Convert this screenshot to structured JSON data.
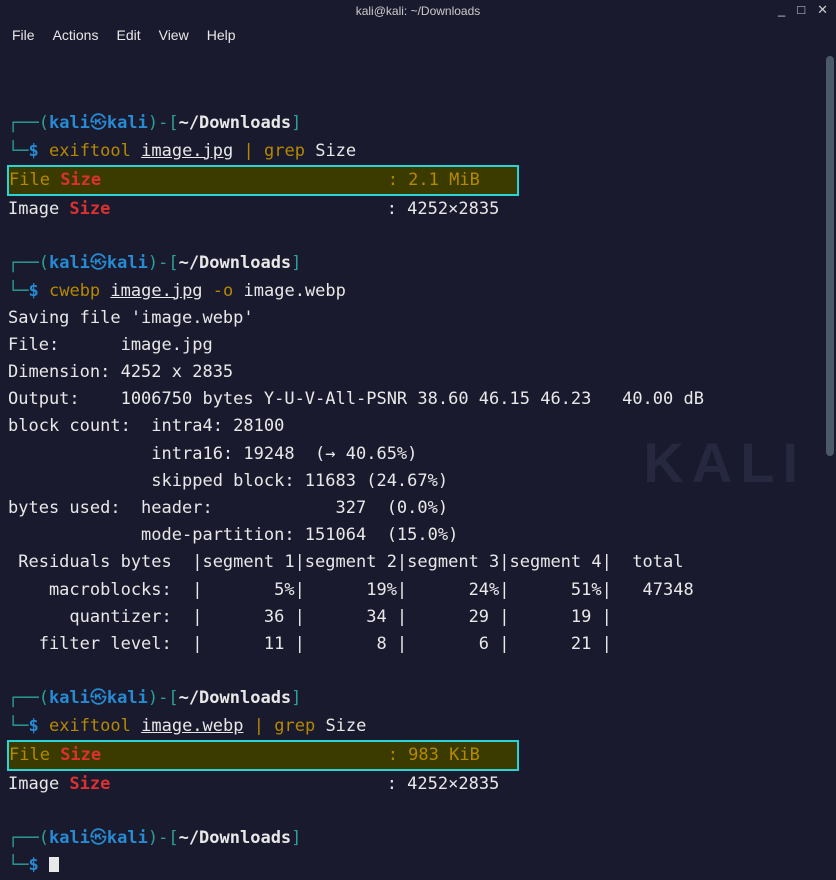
{
  "window": {
    "title": "kali@kali: ~/Downloads",
    "controls": {
      "min": "_",
      "max": "□",
      "close": "✕"
    }
  },
  "menu": {
    "file": "File",
    "actions": "Actions",
    "edit": "Edit",
    "view": "View",
    "help": "Help"
  },
  "prompt": {
    "user": "kali",
    "host": "kali",
    "path": "~/Downloads",
    "open_top": "┌──(",
    "close_top": ")-[",
    "close_br": "]",
    "open_bot": "└─",
    "dollar": "$"
  },
  "cmd1": {
    "c": "exiftool",
    "arg": "image.jpg",
    "pipe": "|",
    "g": "grep",
    "garg": "Size"
  },
  "out1": {
    "l1a": "File ",
    "l1b": "Size",
    "l1c": "                            : 2.1 MiB",
    "l2a": "Image ",
    "l2b": "Size",
    "l2c": "                           : 4252×2835"
  },
  "cmd2": {
    "c": "cwebp",
    "arg": "image.jpg",
    "flag": "-o",
    "arg2": "image.webp"
  },
  "out2": {
    "l1": "Saving file 'image.webp'",
    "l2": "File:      image.jpg",
    "l3": "Dimension: 4252 x 2835",
    "l4": "Output:    1006750 bytes Y-U-V-All-PSNR 38.60 46.15 46.23   40.00 dB",
    "l5": "block count:  intra4: 28100",
    "l6": "              intra16: 19248  (→ 40.65%)",
    "l7": "              skipped block: 11683 (24.67%)",
    "l8": "bytes used:  header:            327  (0.0%)",
    "l9": "             mode-partition: 151064  (15.0%)",
    "l10": " Residuals bytes  |segment 1|segment 2|segment 3|segment 4|  total",
    "l11": "    macroblocks:  |       5%|      19%|      24%|      51%|   47348",
    "l12": "      quantizer:  |      36 |      34 |      29 |      19 |",
    "l13": "   filter level:  |      11 |       8 |       6 |      21 |"
  },
  "cmd3": {
    "c": "exiftool",
    "arg": "image.webp",
    "pipe": "|",
    "g": "grep",
    "garg": "Size"
  },
  "out3": {
    "l1a": "File ",
    "l1b": "Size",
    "l1c": "                            : 983 KiB",
    "l2a": "Image ",
    "l2b": "Size",
    "l2c": "                           : 4252×2835"
  },
  "watermark": "KALI"
}
